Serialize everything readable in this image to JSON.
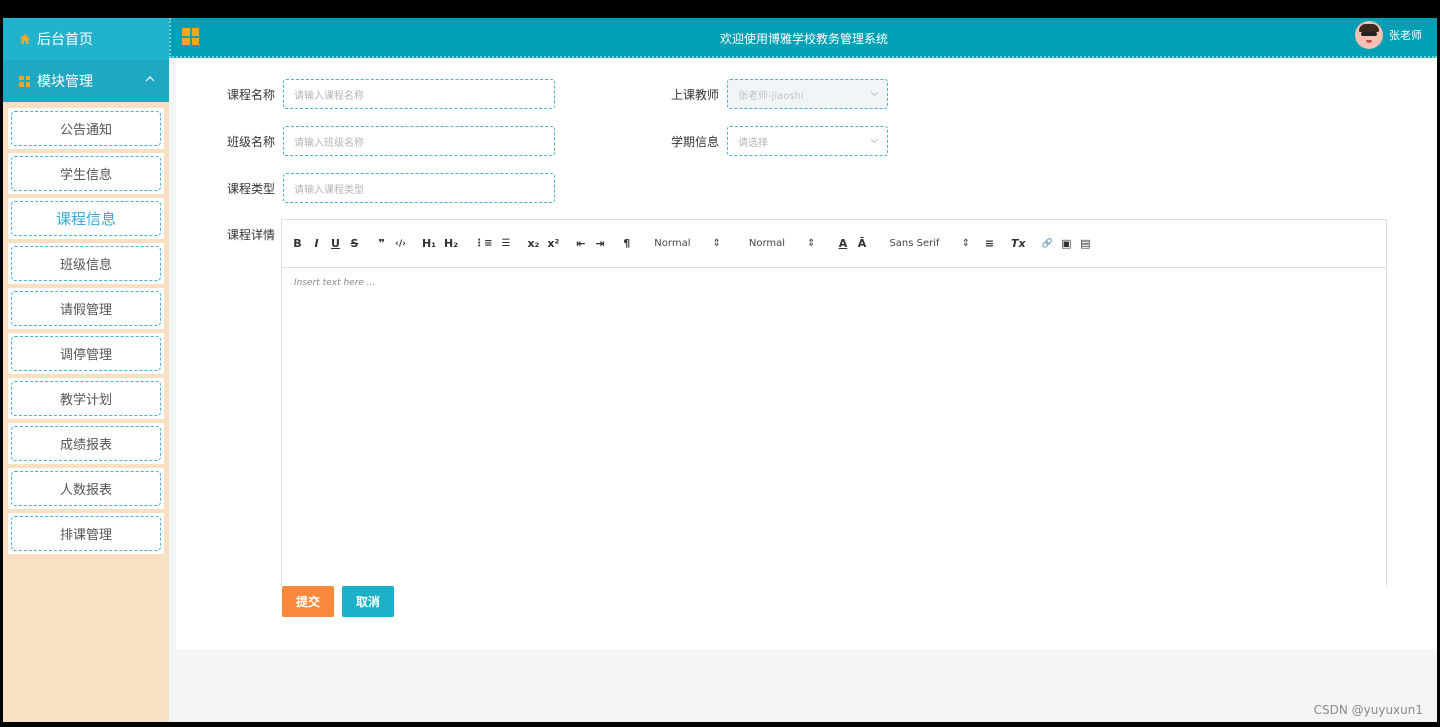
{
  "header": {
    "title": "欢迎使用博雅学校教务管理系统",
    "user_name": "张老师"
  },
  "sidebar": {
    "home_label": "后台首页",
    "module_label": "模块管理",
    "items": [
      {
        "label": "公告通知"
      },
      {
        "label": "学生信息"
      },
      {
        "label": "课程信息"
      },
      {
        "label": "班级信息"
      },
      {
        "label": "请假管理"
      },
      {
        "label": "调停管理"
      },
      {
        "label": "教学计划"
      },
      {
        "label": "成绩报表"
      },
      {
        "label": "人数报表"
      },
      {
        "label": "排课管理"
      }
    ]
  },
  "form": {
    "course_name": {
      "label": "课程名称",
      "placeholder": "请输入课程名称"
    },
    "teacher": {
      "label": "上课教师",
      "value": "张老师-jiaoshi"
    },
    "class_name": {
      "label": "班级名称",
      "placeholder": "请输入班级名称"
    },
    "semester": {
      "label": "学期信息",
      "placeholder": "请选择"
    },
    "course_type": {
      "label": "课程类型",
      "placeholder": "请输入课程类型"
    },
    "details": {
      "label": "课程详情",
      "placeholder": "Insert text here ...",
      "toolbar": {
        "bold": "B",
        "italic": "I",
        "underline": "U",
        "strike": "S",
        "quote": "❞",
        "code": "‹/›",
        "h1": "H₁",
        "h2": "H₂",
        "ordered_list": "⋮≡",
        "bullet_list": "☰",
        "subscript": "x₂",
        "superscript": "x²",
        "outdent": "⇤",
        "indent": "⇥",
        "direction": "¶",
        "size_select": "Normal",
        "header_select": "Normal",
        "font_color": "A",
        "background": "Ā",
        "font_select": "Sans Serif",
        "align": "≡",
        "clean": "Tx",
        "link": "🔗",
        "image": "▣",
        "video": "▤"
      }
    },
    "submit_label": "提交",
    "cancel_label": "取消"
  },
  "watermark": "CSDN @yuyuxun1",
  "colors": {
    "accent": "#03a0b5",
    "sidebar_bg": "#f8e0c0",
    "submit": "#f98a3c",
    "cancel": "#1ab1c9"
  }
}
